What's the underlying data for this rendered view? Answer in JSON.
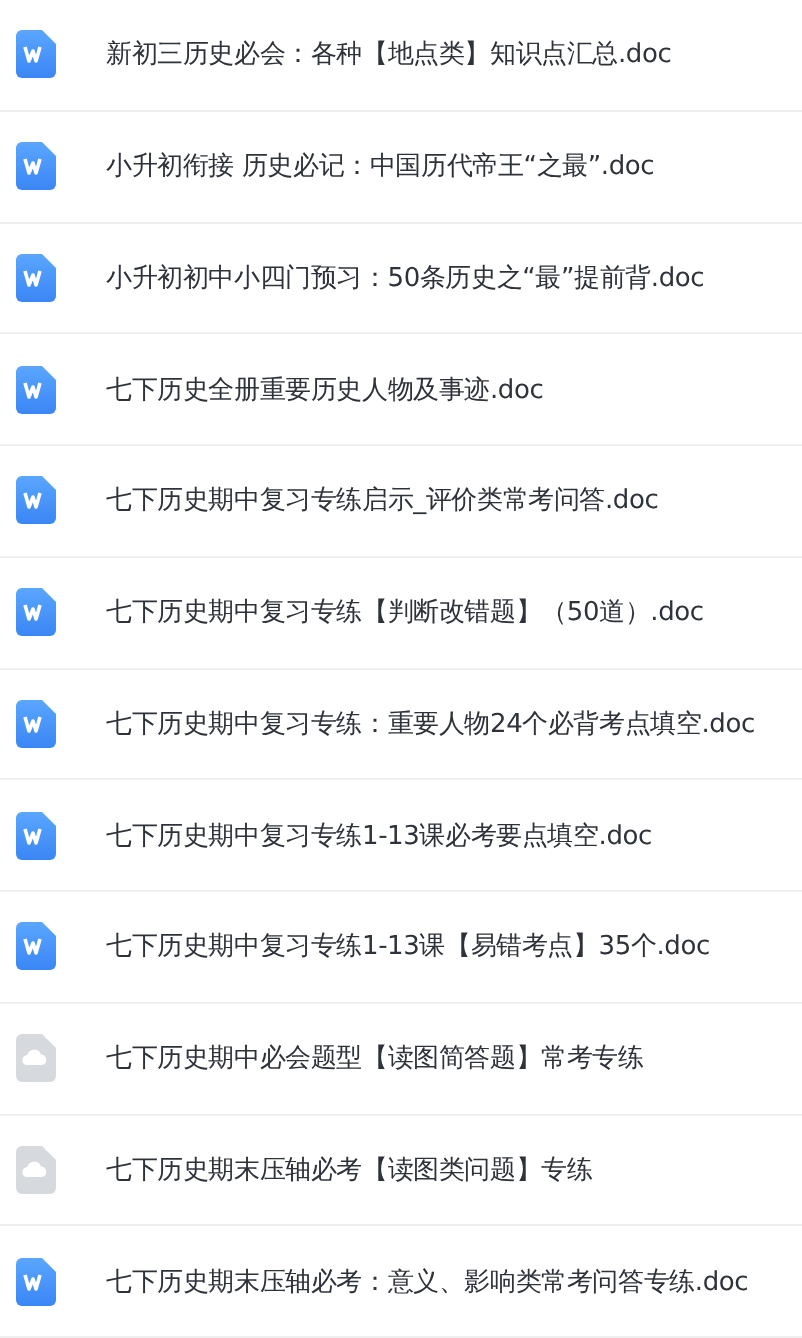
{
  "files": [
    {
      "kind": "word",
      "name": "新初三历史必会：各种【地点类】知识点汇总.doc"
    },
    {
      "kind": "word",
      "name": "小升初衔接 历史必记：中国历代帝王“之最”.doc"
    },
    {
      "kind": "word",
      "name": "小升初初中小四门预习：50条历史之“最”提前背.doc"
    },
    {
      "kind": "word",
      "name": "七下历史全册重要历史人物及事迹.doc"
    },
    {
      "kind": "word",
      "name": "七下历史期中复习专练启示_评价类常考问答.doc"
    },
    {
      "kind": "word",
      "name": "七下历史期中复习专练【判断改错题】（50道）.doc"
    },
    {
      "kind": "word",
      "name": "七下历史期中复习专练：重要人物24个必背考点填空.doc"
    },
    {
      "kind": "word",
      "name": "七下历史期中复习专练1-13课必考要点填空.doc"
    },
    {
      "kind": "word",
      "name": "七下历史期中复习专练1-13课【易错考点】35个.doc"
    },
    {
      "kind": "cloud",
      "name": "七下历史期中必会题型【读图简答题】常考专练"
    },
    {
      "kind": "cloud",
      "name": "七下历史期末压轴必考【读图类问题】专练"
    },
    {
      "kind": "word",
      "name": "七下历史期末压轴必考：意义、影响类常考问答专练.doc"
    }
  ]
}
